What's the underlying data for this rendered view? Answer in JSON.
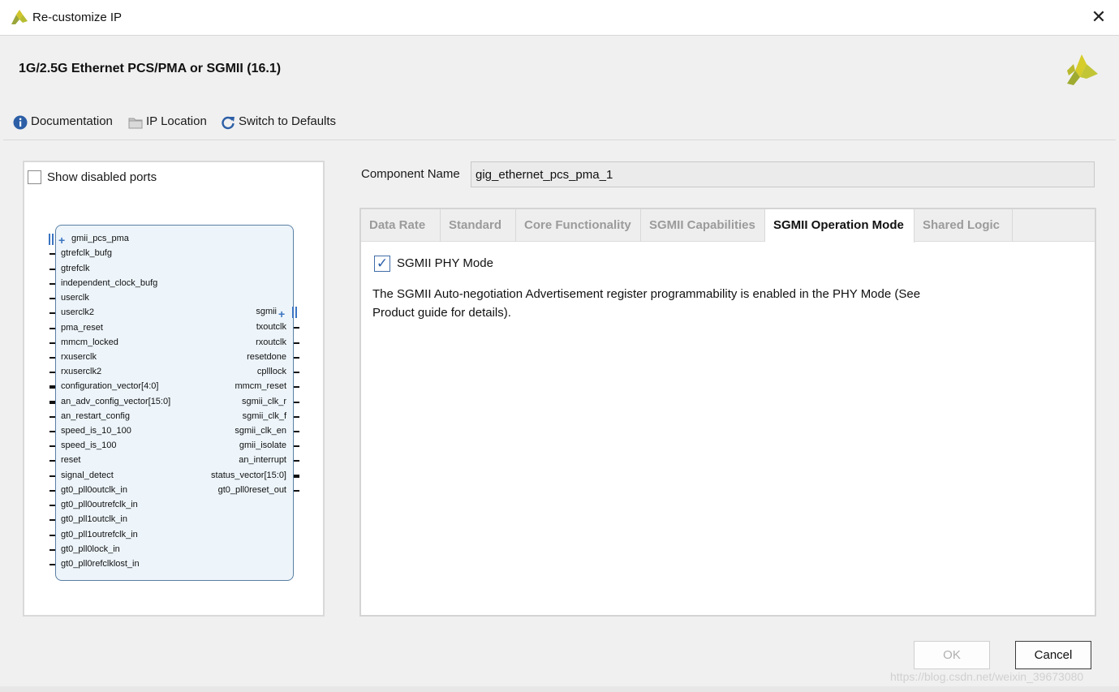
{
  "window": {
    "title": "Re-customize IP",
    "close_label": "✕"
  },
  "header": {
    "ip_name": "1G/2.5G Ethernet PCS/PMA or SGMII (16.1)"
  },
  "toolbar": {
    "documentation": "Documentation",
    "ip_location": "IP Location",
    "switch_defaults": "Switch to Defaults"
  },
  "left_panel": {
    "show_disabled_ports": {
      "label": "Show disabled ports",
      "checked": false
    },
    "block": {
      "left_ports": [
        "gmii_pcs_pma",
        "gtrefclk_bufg",
        "gtrefclk",
        "independent_clock_bufg",
        "userclk",
        "userclk2",
        "pma_reset",
        "mmcm_locked",
        "rxuserclk",
        "rxuserclk2",
        "configuration_vector[4:0]",
        "an_adv_config_vector[15:0]",
        "an_restart_config",
        "speed_is_10_100",
        "speed_is_100",
        "reset",
        "signal_detect",
        "gt0_pll0outclk_in",
        "gt0_pll0outrefclk_in",
        "gt0_pll1outclk_in",
        "gt0_pll1outrefclk_in",
        "gt0_pll0lock_in",
        "gt0_pll0refclklost_in"
      ],
      "right_ports": [
        "sgmii",
        "txoutclk",
        "rxoutclk",
        "resetdone",
        "cplllock",
        "mmcm_reset",
        "sgmii_clk_r",
        "sgmii_clk_f",
        "sgmii_clk_en",
        "gmii_isolate",
        "an_interrupt",
        "status_vector[15:0]",
        "gt0_pll0reset_out"
      ]
    }
  },
  "component": {
    "label": "Component Name",
    "value": "gig_ethernet_pcs_pma_1"
  },
  "tabs": [
    {
      "label": "Data Rate"
    },
    {
      "label": "Standard"
    },
    {
      "label": "Core Functionality"
    },
    {
      "label": "SGMII Capabilities"
    },
    {
      "label": "SGMII Operation Mode",
      "active": true
    },
    {
      "label": "Shared Logic"
    }
  ],
  "sgmii_operation_mode": {
    "phy_mode": {
      "label": "SGMII PHY Mode",
      "checked": true
    },
    "description_line1": "The SGMII Auto-negotiation Advertisement register programmability is enabled in the PHY Mode (See",
    "description_line2": "Product guide for details)."
  },
  "buttons": {
    "ok": "OK",
    "cancel": "Cancel"
  },
  "watermark": "https://blog.csdn.net/weixin_39673080",
  "colors": {
    "accent": "#3b74c1",
    "brand_yellow": "#c8c224",
    "brand_green": "#a7b42f"
  },
  "icons": {
    "info": "info-icon",
    "folder": "folder-icon",
    "refresh": "refresh-icon",
    "close": "close-icon",
    "logo": "xilinx-logo-icon"
  }
}
